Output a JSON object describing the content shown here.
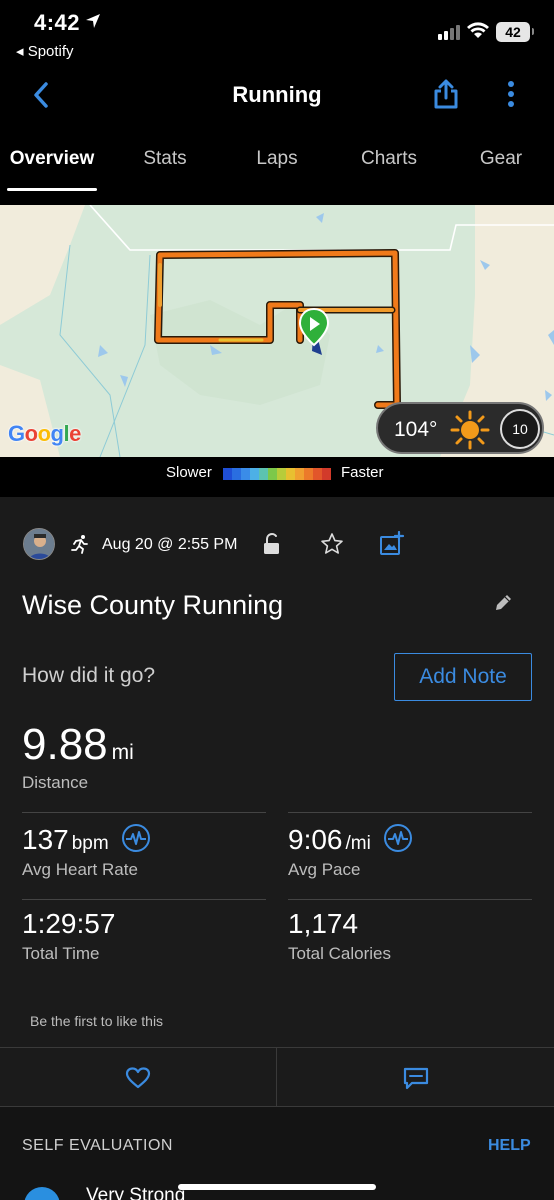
{
  "status_bar": {
    "time": "4:42",
    "back_app": "◂ Spotify",
    "battery": "42"
  },
  "nav": {
    "title": "Running"
  },
  "tabs": [
    "Overview",
    "Stats",
    "Laps",
    "Charts",
    "Gear"
  ],
  "map": {
    "attribution": "Google",
    "temperature": "104°",
    "wind": "10",
    "legend": {
      "slow_label": "Slower",
      "fast_label": "Faster",
      "colors": [
        "#1f4fd6",
        "#2a6ee0",
        "#3a8ce8",
        "#4db0e6",
        "#5cc3b0",
        "#7cc84a",
        "#b8cc3a",
        "#e8c030",
        "#f0a030",
        "#ec7a2a",
        "#e2562a",
        "#d23a2a"
      ]
    }
  },
  "activity": {
    "date": "Aug 20 @ 2:55 PM",
    "title": "Wise County Running",
    "note_prompt": "How did it go?",
    "add_note": "Add Note"
  },
  "distance": {
    "value": "9.88",
    "unit": "mi",
    "label": "Distance"
  },
  "stats": [
    {
      "value": "137",
      "unit": "bpm",
      "label": "Avg Heart Rate"
    },
    {
      "value": "9:06",
      "unit": "/mi",
      "label": "Avg Pace"
    },
    {
      "value": "1:29:57",
      "unit": "",
      "label": "Total Time"
    },
    {
      "value": "1,174",
      "unit": "",
      "label": "Total Calories"
    }
  ],
  "social": {
    "like_prompt": "Be the first to like this"
  },
  "self_evaluation": {
    "heading": "SELF EVALUATION",
    "help": "HELP",
    "first_option": "Very Strong"
  },
  "colors": {
    "accent": "#3b8be0",
    "route": "#f07a1a"
  }
}
